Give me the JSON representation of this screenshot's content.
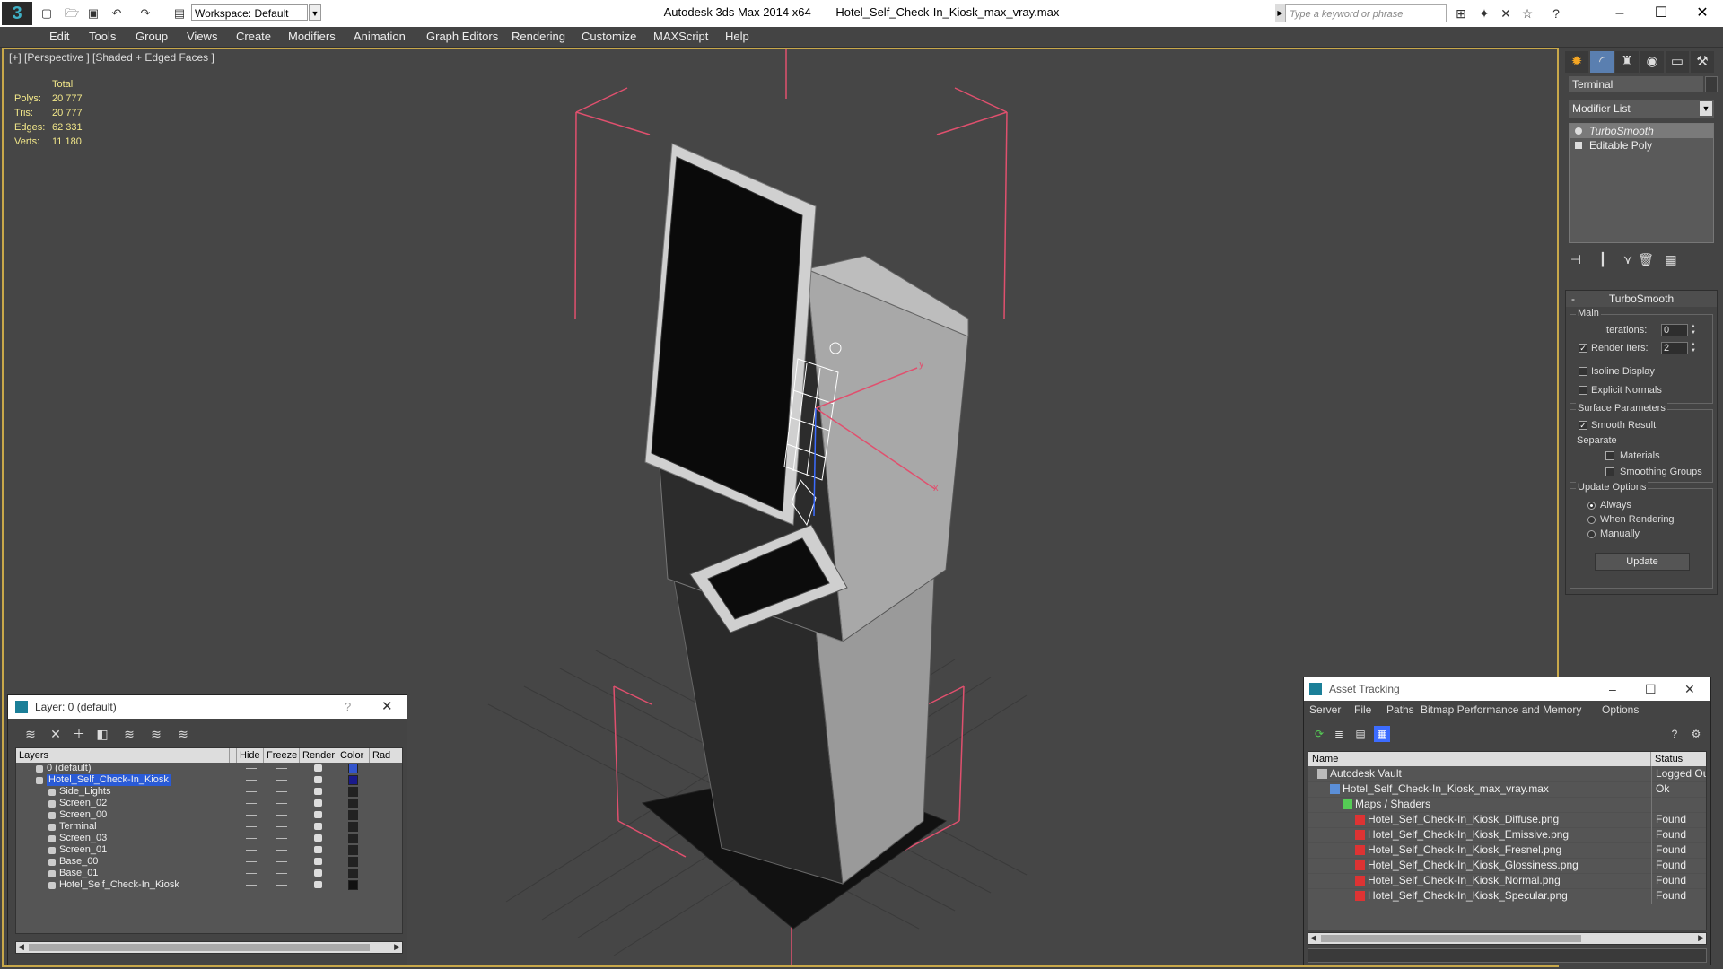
{
  "titlebar": {
    "app_name": "Autodesk 3ds Max  2014 x64",
    "file_name": "Hotel_Self_Check-In_Kiosk_max_vray.max",
    "workspace_label": "Workspace: Default",
    "search_placeholder": "Type a keyword or phrase"
  },
  "menu": [
    "Edit",
    "Tools",
    "Group",
    "Views",
    "Create",
    "Modifiers",
    "Animation",
    "Graph Editors",
    "Rendering",
    "Customize",
    "MAXScript",
    "Help"
  ],
  "viewport": {
    "label": "[+] [Perspective ] [Shaded + Edged Faces ]",
    "stats_header": "Total",
    "stats": [
      {
        "key": "Polys:",
        "value": "20 777"
      },
      {
        "key": "Tris:",
        "value": "20 777"
      },
      {
        "key": "Edges:",
        "value": "62 331"
      },
      {
        "key": "Verts:",
        "value": "11 180"
      }
    ],
    "gizmo_x": "x",
    "gizmo_y": "y"
  },
  "command_panel": {
    "object_name": "Terminal",
    "modifier_list": "Modifier List",
    "stack": [
      "TurboSmooth",
      "Editable Poly"
    ],
    "rollout_title": "TurboSmooth",
    "main_label": "Main",
    "iterations_label": "Iterations:",
    "iterations_value": "0",
    "render_iters_label": "Render Iters:",
    "render_iters_value": "2",
    "render_iters_checked": true,
    "isoline_label": "Isoline Display",
    "explicit_normals_label": "Explicit Normals",
    "surface_params_label": "Surface Parameters",
    "smooth_result_label": "Smooth Result",
    "smooth_result_checked": true,
    "separate_label": "Separate",
    "materials_label": "Materials",
    "smoothing_groups_label": "Smoothing Groups",
    "update_options_label": "Update Options",
    "always_label": "Always",
    "when_rendering_label": "When Rendering",
    "manually_label": "Manually",
    "update_button": "Update"
  },
  "layer_dialog": {
    "title": "Layer: 0 (default)",
    "help_glyph": "?",
    "columns": [
      "Layers",
      "Hide",
      "Freeze",
      "Render",
      "Color",
      "Rad"
    ],
    "rows": [
      {
        "name": "0 (default)",
        "indent": 0,
        "color": "#3355cc",
        "selected": false
      },
      {
        "name": "Hotel_Self_Check-In_Kiosk",
        "indent": 0,
        "color": "#1a1a8a",
        "selected": true
      },
      {
        "name": "Side_Lights",
        "indent": 1,
        "color": "#222222",
        "selected": false
      },
      {
        "name": "Screen_02",
        "indent": 1,
        "color": "#222222",
        "selected": false
      },
      {
        "name": "Screen_00",
        "indent": 1,
        "color": "#222222",
        "selected": false
      },
      {
        "name": "Terminal",
        "indent": 1,
        "color": "#222222",
        "selected": false
      },
      {
        "name": "Screen_03",
        "indent": 1,
        "color": "#222222",
        "selected": false
      },
      {
        "name": "Screen_01",
        "indent": 1,
        "color": "#222222",
        "selected": false
      },
      {
        "name": "Base_00",
        "indent": 1,
        "color": "#222222",
        "selected": false
      },
      {
        "name": "Base_01",
        "indent": 1,
        "color": "#222222",
        "selected": false
      },
      {
        "name": "Hotel_Self_Check-In_Kiosk",
        "indent": 1,
        "color": "#111111",
        "selected": false
      }
    ]
  },
  "asset_dialog": {
    "title": "Asset Tracking",
    "menu": [
      "Server",
      "File",
      "Paths",
      "Bitmap Performance and Memory",
      "Options"
    ],
    "columns": [
      "Name",
      "Status"
    ],
    "rows": [
      {
        "name": "Autodesk Vault",
        "indent": 0,
        "status": "Logged Out",
        "icon": "vault"
      },
      {
        "name": "Hotel_Self_Check-In_Kiosk_max_vray.max",
        "indent": 1,
        "status": "Ok",
        "icon": "max"
      },
      {
        "name": "Maps / Shaders",
        "indent": 2,
        "status": "",
        "icon": "maps"
      },
      {
        "name": "Hotel_Self_Check-In_Kiosk_Diffuse.png",
        "indent": 3,
        "status": "Found",
        "icon": "png"
      },
      {
        "name": "Hotel_Self_Check-In_Kiosk_Emissive.png",
        "indent": 3,
        "status": "Found",
        "icon": "png"
      },
      {
        "name": "Hotel_Self_Check-In_Kiosk_Fresnel.png",
        "indent": 3,
        "status": "Found",
        "icon": "png"
      },
      {
        "name": "Hotel_Self_Check-In_Kiosk_Glossiness.png",
        "indent": 3,
        "status": "Found",
        "icon": "png"
      },
      {
        "name": "Hotel_Self_Check-In_Kiosk_Normal.png",
        "indent": 3,
        "status": "Found",
        "icon": "png"
      },
      {
        "name": "Hotel_Self_Check-In_Kiosk_Specular.png",
        "indent": 3,
        "status": "Found",
        "icon": "png"
      }
    ]
  },
  "colors": {
    "viewport_border": "#c8a84a",
    "stats_text": "#f3e88a",
    "bbox_lines": "#e0506e",
    "selection": "#2a5bd7"
  }
}
